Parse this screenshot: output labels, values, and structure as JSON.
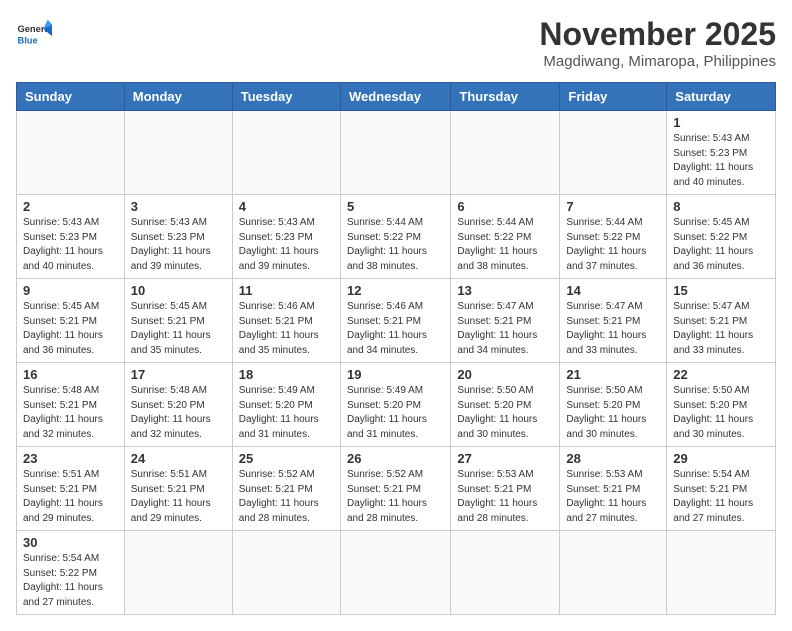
{
  "header": {
    "logo_general": "General",
    "logo_blue": "Blue",
    "month_title": "November 2025",
    "location": "Magdiwang, Mimaropa, Philippines"
  },
  "days_of_week": [
    "Sunday",
    "Monday",
    "Tuesday",
    "Wednesday",
    "Thursday",
    "Friday",
    "Saturday"
  ],
  "weeks": [
    [
      {
        "day": "",
        "sunrise": "",
        "sunset": "",
        "daylight": ""
      },
      {
        "day": "",
        "sunrise": "",
        "sunset": "",
        "daylight": ""
      },
      {
        "day": "",
        "sunrise": "",
        "sunset": "",
        "daylight": ""
      },
      {
        "day": "",
        "sunrise": "",
        "sunset": "",
        "daylight": ""
      },
      {
        "day": "",
        "sunrise": "",
        "sunset": "",
        "daylight": ""
      },
      {
        "day": "",
        "sunrise": "",
        "sunset": "",
        "daylight": ""
      },
      {
        "day": "1",
        "sunrise": "Sunrise: 5:43 AM",
        "sunset": "Sunset: 5:23 PM",
        "daylight": "Daylight: 11 hours and 40 minutes."
      }
    ],
    [
      {
        "day": "2",
        "sunrise": "Sunrise: 5:43 AM",
        "sunset": "Sunset: 5:23 PM",
        "daylight": "Daylight: 11 hours and 40 minutes."
      },
      {
        "day": "3",
        "sunrise": "Sunrise: 5:43 AM",
        "sunset": "Sunset: 5:23 PM",
        "daylight": "Daylight: 11 hours and 39 minutes."
      },
      {
        "day": "4",
        "sunrise": "Sunrise: 5:43 AM",
        "sunset": "Sunset: 5:23 PM",
        "daylight": "Daylight: 11 hours and 39 minutes."
      },
      {
        "day": "5",
        "sunrise": "Sunrise: 5:44 AM",
        "sunset": "Sunset: 5:22 PM",
        "daylight": "Daylight: 11 hours and 38 minutes."
      },
      {
        "day": "6",
        "sunrise": "Sunrise: 5:44 AM",
        "sunset": "Sunset: 5:22 PM",
        "daylight": "Daylight: 11 hours and 38 minutes."
      },
      {
        "day": "7",
        "sunrise": "Sunrise: 5:44 AM",
        "sunset": "Sunset: 5:22 PM",
        "daylight": "Daylight: 11 hours and 37 minutes."
      },
      {
        "day": "8",
        "sunrise": "Sunrise: 5:45 AM",
        "sunset": "Sunset: 5:22 PM",
        "daylight": "Daylight: 11 hours and 36 minutes."
      }
    ],
    [
      {
        "day": "9",
        "sunrise": "Sunrise: 5:45 AM",
        "sunset": "Sunset: 5:21 PM",
        "daylight": "Daylight: 11 hours and 36 minutes."
      },
      {
        "day": "10",
        "sunrise": "Sunrise: 5:45 AM",
        "sunset": "Sunset: 5:21 PM",
        "daylight": "Daylight: 11 hours and 35 minutes."
      },
      {
        "day": "11",
        "sunrise": "Sunrise: 5:46 AM",
        "sunset": "Sunset: 5:21 PM",
        "daylight": "Daylight: 11 hours and 35 minutes."
      },
      {
        "day": "12",
        "sunrise": "Sunrise: 5:46 AM",
        "sunset": "Sunset: 5:21 PM",
        "daylight": "Daylight: 11 hours and 34 minutes."
      },
      {
        "day": "13",
        "sunrise": "Sunrise: 5:47 AM",
        "sunset": "Sunset: 5:21 PM",
        "daylight": "Daylight: 11 hours and 34 minutes."
      },
      {
        "day": "14",
        "sunrise": "Sunrise: 5:47 AM",
        "sunset": "Sunset: 5:21 PM",
        "daylight": "Daylight: 11 hours and 33 minutes."
      },
      {
        "day": "15",
        "sunrise": "Sunrise: 5:47 AM",
        "sunset": "Sunset: 5:21 PM",
        "daylight": "Daylight: 11 hours and 33 minutes."
      }
    ],
    [
      {
        "day": "16",
        "sunrise": "Sunrise: 5:48 AM",
        "sunset": "Sunset: 5:21 PM",
        "daylight": "Daylight: 11 hours and 32 minutes."
      },
      {
        "day": "17",
        "sunrise": "Sunrise: 5:48 AM",
        "sunset": "Sunset: 5:20 PM",
        "daylight": "Daylight: 11 hours and 32 minutes."
      },
      {
        "day": "18",
        "sunrise": "Sunrise: 5:49 AM",
        "sunset": "Sunset: 5:20 PM",
        "daylight": "Daylight: 11 hours and 31 minutes."
      },
      {
        "day": "19",
        "sunrise": "Sunrise: 5:49 AM",
        "sunset": "Sunset: 5:20 PM",
        "daylight": "Daylight: 11 hours and 31 minutes."
      },
      {
        "day": "20",
        "sunrise": "Sunrise: 5:50 AM",
        "sunset": "Sunset: 5:20 PM",
        "daylight": "Daylight: 11 hours and 30 minutes."
      },
      {
        "day": "21",
        "sunrise": "Sunrise: 5:50 AM",
        "sunset": "Sunset: 5:20 PM",
        "daylight": "Daylight: 11 hours and 30 minutes."
      },
      {
        "day": "22",
        "sunrise": "Sunrise: 5:50 AM",
        "sunset": "Sunset: 5:20 PM",
        "daylight": "Daylight: 11 hours and 30 minutes."
      }
    ],
    [
      {
        "day": "23",
        "sunrise": "Sunrise: 5:51 AM",
        "sunset": "Sunset: 5:21 PM",
        "daylight": "Daylight: 11 hours and 29 minutes."
      },
      {
        "day": "24",
        "sunrise": "Sunrise: 5:51 AM",
        "sunset": "Sunset: 5:21 PM",
        "daylight": "Daylight: 11 hours and 29 minutes."
      },
      {
        "day": "25",
        "sunrise": "Sunrise: 5:52 AM",
        "sunset": "Sunset: 5:21 PM",
        "daylight": "Daylight: 11 hours and 28 minutes."
      },
      {
        "day": "26",
        "sunrise": "Sunrise: 5:52 AM",
        "sunset": "Sunset: 5:21 PM",
        "daylight": "Daylight: 11 hours and 28 minutes."
      },
      {
        "day": "27",
        "sunrise": "Sunrise: 5:53 AM",
        "sunset": "Sunset: 5:21 PM",
        "daylight": "Daylight: 11 hours and 28 minutes."
      },
      {
        "day": "28",
        "sunrise": "Sunrise: 5:53 AM",
        "sunset": "Sunset: 5:21 PM",
        "daylight": "Daylight: 11 hours and 27 minutes."
      },
      {
        "day": "29",
        "sunrise": "Sunrise: 5:54 AM",
        "sunset": "Sunset: 5:21 PM",
        "daylight": "Daylight: 11 hours and 27 minutes."
      }
    ],
    [
      {
        "day": "30",
        "sunrise": "Sunrise: 5:54 AM",
        "sunset": "Sunset: 5:22 PM",
        "daylight": "Daylight: 11 hours and 27 minutes."
      },
      {
        "day": "",
        "sunrise": "",
        "sunset": "",
        "daylight": ""
      },
      {
        "day": "",
        "sunrise": "",
        "sunset": "",
        "daylight": ""
      },
      {
        "day": "",
        "sunrise": "",
        "sunset": "",
        "daylight": ""
      },
      {
        "day": "",
        "sunrise": "",
        "sunset": "",
        "daylight": ""
      },
      {
        "day": "",
        "sunrise": "",
        "sunset": "",
        "daylight": ""
      },
      {
        "day": "",
        "sunrise": "",
        "sunset": "",
        "daylight": ""
      }
    ]
  ]
}
